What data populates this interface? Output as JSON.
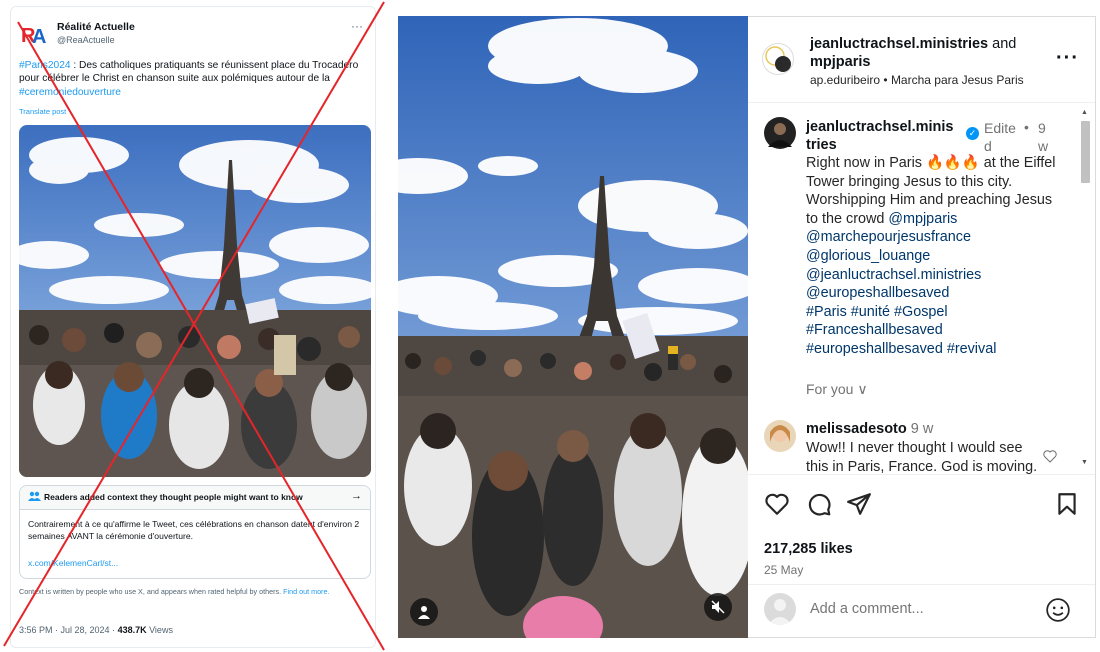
{
  "tweet": {
    "display_name": "Réalité Actuelle",
    "handle": "@ReaActuelle",
    "logo_letters": [
      "R",
      "A"
    ],
    "more": "···",
    "text_hashtag_1": "#Paris2024",
    "text_body": " : Des catholiques pratiquants se réunissent place du Trocadero pour célébrer le Christ en chanson suite aux polémiques autour de la ",
    "text_hashtag_2": "#ceremoniedouverture",
    "translate": "Translate post",
    "note_title": "Readers added context they thought people might want to know",
    "note_arrow": "→",
    "note_body": "Contrairement à ce qu'affirme le Tweet, ces célébrations en chanson datent d'environ 2 semaines AVANT la cérémonie d'ouverture.",
    "note_link": "x.com/KelemenCarl/st...",
    "footnote_text": "Context is written by people who use X, and appears when rated helpful by others. ",
    "footnote_link": "Find out more.",
    "time": "3:56 PM · Jul 28, 2024 · ",
    "views_count": "438.7K",
    "views_label": " Views"
  },
  "instagram": {
    "header": {
      "owner": "jeanluctrachsel.ministries",
      "and": " and ",
      "collab": "mpjparis",
      "sub_user": "ap.eduribeiro",
      "sub_sep": " • ",
      "sub_place": "Marcha para Jesus Paris",
      "more": "···"
    },
    "caption": {
      "username": "jeanluctrachsel.ministries",
      "edited": "Edited",
      "dot": "•",
      "ago": "9w",
      "line1": "Right now in Paris 🔥🔥🔥 at the Eiffel Tower bringing Jesus to this city. Worshipping Him and preaching Jesus to the crowd ",
      "mentions": [
        "@mpjparis",
        "@marchepourjesusfrance",
        "@glorious_louange",
        "@jeanluctrachsel.ministries",
        "@europeshallbesaved"
      ],
      "hashtags_line1": "#Paris #unité #Gospel",
      "hashtags_line2": "#Franceshallbesaved",
      "hashtags_line3": "#europeshallbesaved #revival"
    },
    "for_you": "For you ∨",
    "comment": {
      "username": "melissadesoto",
      "ago": " 9 w",
      "text": "Wow!! I never thought I would see this in Paris, France. God is moving."
    },
    "likes": "217,285 likes",
    "date": "25 May",
    "add_comment_placeholder": "Add a comment..."
  },
  "icons": {
    "heart": "heart-icon",
    "comment": "comment-icon",
    "share": "share-icon",
    "save": "bookmark-icon",
    "mute": "mute-icon",
    "user": "user-tag-icon",
    "emoji": "emoji-icon"
  },
  "colors": {
    "twitter_blue": "#1d9bf0",
    "cross_red": "#e5252a",
    "ig_link": "#00376b",
    "ig_verified": "#0095f6"
  }
}
